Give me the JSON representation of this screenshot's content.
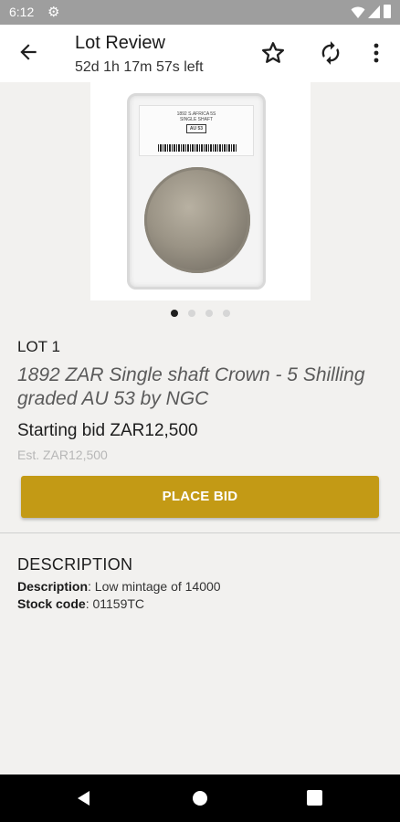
{
  "status_bar": {
    "time": "6:12"
  },
  "app_bar": {
    "title": "Lot Review",
    "subtitle": "52d 1h 17m 57s left"
  },
  "gallery": {
    "slab_label_line1": "1892 S.AFRICA 5S",
    "slab_label_line2": "SINGLE SHAFT",
    "slab_grade": "AU 53",
    "image_count": 4,
    "active_index": 0
  },
  "lot": {
    "number": "LOT 1",
    "title": "1892 ZAR Single shaft Crown - 5 Shilling graded AU 53 by NGC",
    "starting_bid": "Starting bid ZAR12,500",
    "estimate": "Est. ZAR12,500",
    "place_bid_label": "PLACE BID"
  },
  "description": {
    "heading": "DESCRIPTION",
    "rows": [
      {
        "label": "Description",
        "value": ": Low mintage of 14000"
      },
      {
        "label": "Stock code",
        "value": ": 01159TC"
      }
    ]
  },
  "colors": {
    "accent": "#c39a15",
    "background": "#f2f1ef",
    "status_bar": "#9e9e9e"
  },
  "icons": {
    "back": "arrow-left-icon",
    "favorite": "star-outline-icon",
    "refresh": "refresh-icon",
    "more": "more-vertical-icon",
    "settings": "gear-icon"
  }
}
